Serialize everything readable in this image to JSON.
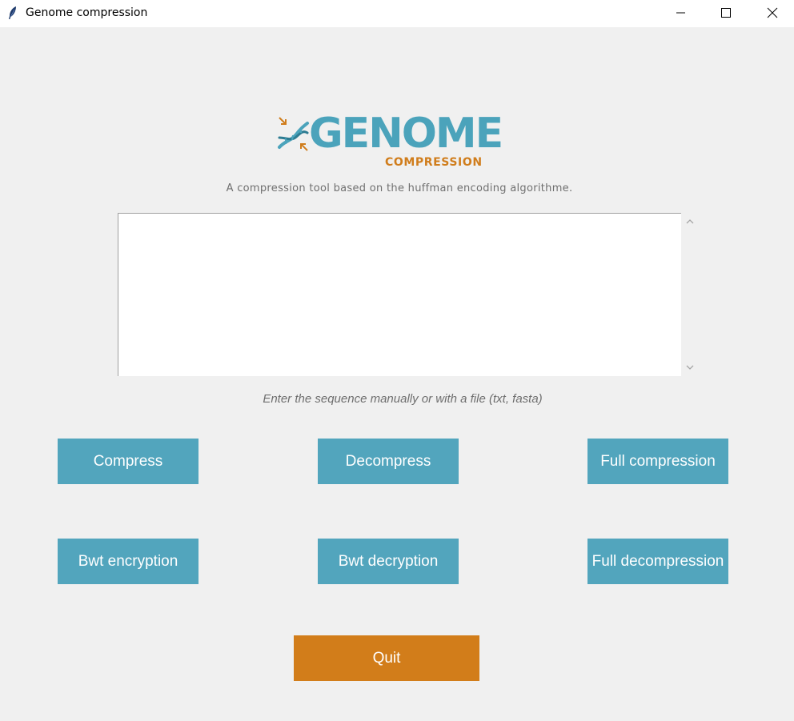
{
  "window": {
    "title": "Genome compression",
    "icon": "feather-icon"
  },
  "logo": {
    "main_text": "GENOME",
    "sub_text": "COMPRESSION",
    "icon": "dna-compress-icon"
  },
  "tagline": "A compression tool based on the huffman encoding algorithme.",
  "sequence_input": {
    "value": "",
    "placeholder": ""
  },
  "hint": "Enter the sequence manually or with a file (txt, fasta)",
  "buttons": {
    "compress": "Compress",
    "decompress": "Decompress",
    "full_compression": "Full compression",
    "bwt_encryption": "Bwt encryption",
    "bwt_decryption": "Bwt decryption",
    "full_decompression": "Full decompression",
    "quit": "Quit"
  },
  "colors": {
    "button": "#52a5bd",
    "quit_button": "#d27d1a",
    "logo_blue": "#4ba3bb",
    "logo_orange": "#d07d1c",
    "background": "#f0f0f0"
  }
}
